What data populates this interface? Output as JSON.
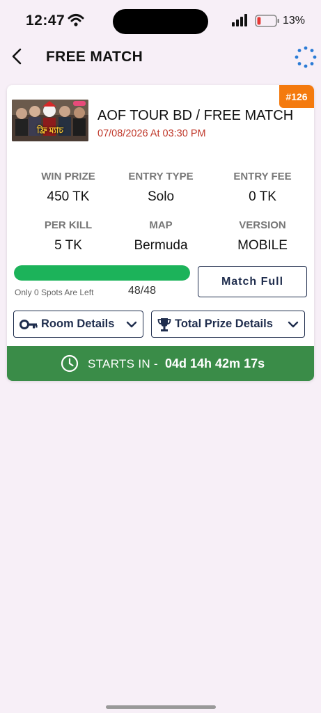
{
  "status_bar": {
    "time": "12:47",
    "battery_percent": "13%",
    "battery_level": 0.13
  },
  "header": {
    "title": "FREE MATCH",
    "back_icon": "chevron-left-icon",
    "refresh_icon": "refresh-icon"
  },
  "match": {
    "id_badge": "#126",
    "title": "AOF TOUR BD / FREE MATCH",
    "datetime": "07/08/2026 At 03:30 PM",
    "thumbnail_text": "ফ্রি ম্যাচ",
    "stats": [
      {
        "label": "WIN PRIZE",
        "value": "450 TK"
      },
      {
        "label": "ENTRY TYPE",
        "value": "Solo"
      },
      {
        "label": "ENTRY FEE",
        "value": "0 TK"
      },
      {
        "label": "PER KILL",
        "value": "5 TK"
      },
      {
        "label": "MAP",
        "value": "Bermuda"
      },
      {
        "label": "VERSION",
        "value": "MOBILE"
      }
    ],
    "spots_left_text": "Only 0 Spots Are Left",
    "spots_count": "48/48",
    "progress_fraction": 1.0,
    "join_button_label": "Match Full",
    "room_details_label": "Room Details",
    "prize_details_label": "Total Prize Details",
    "starts_in_label": "STARTS IN -",
    "countdown": "04d 14h 42m 17s"
  },
  "colors": {
    "accent": "#1f2d4d",
    "badge": "#f47a0e",
    "progress": "#1cb35a",
    "starts_bar": "#3a8c48",
    "datetime": "#c0392b"
  }
}
